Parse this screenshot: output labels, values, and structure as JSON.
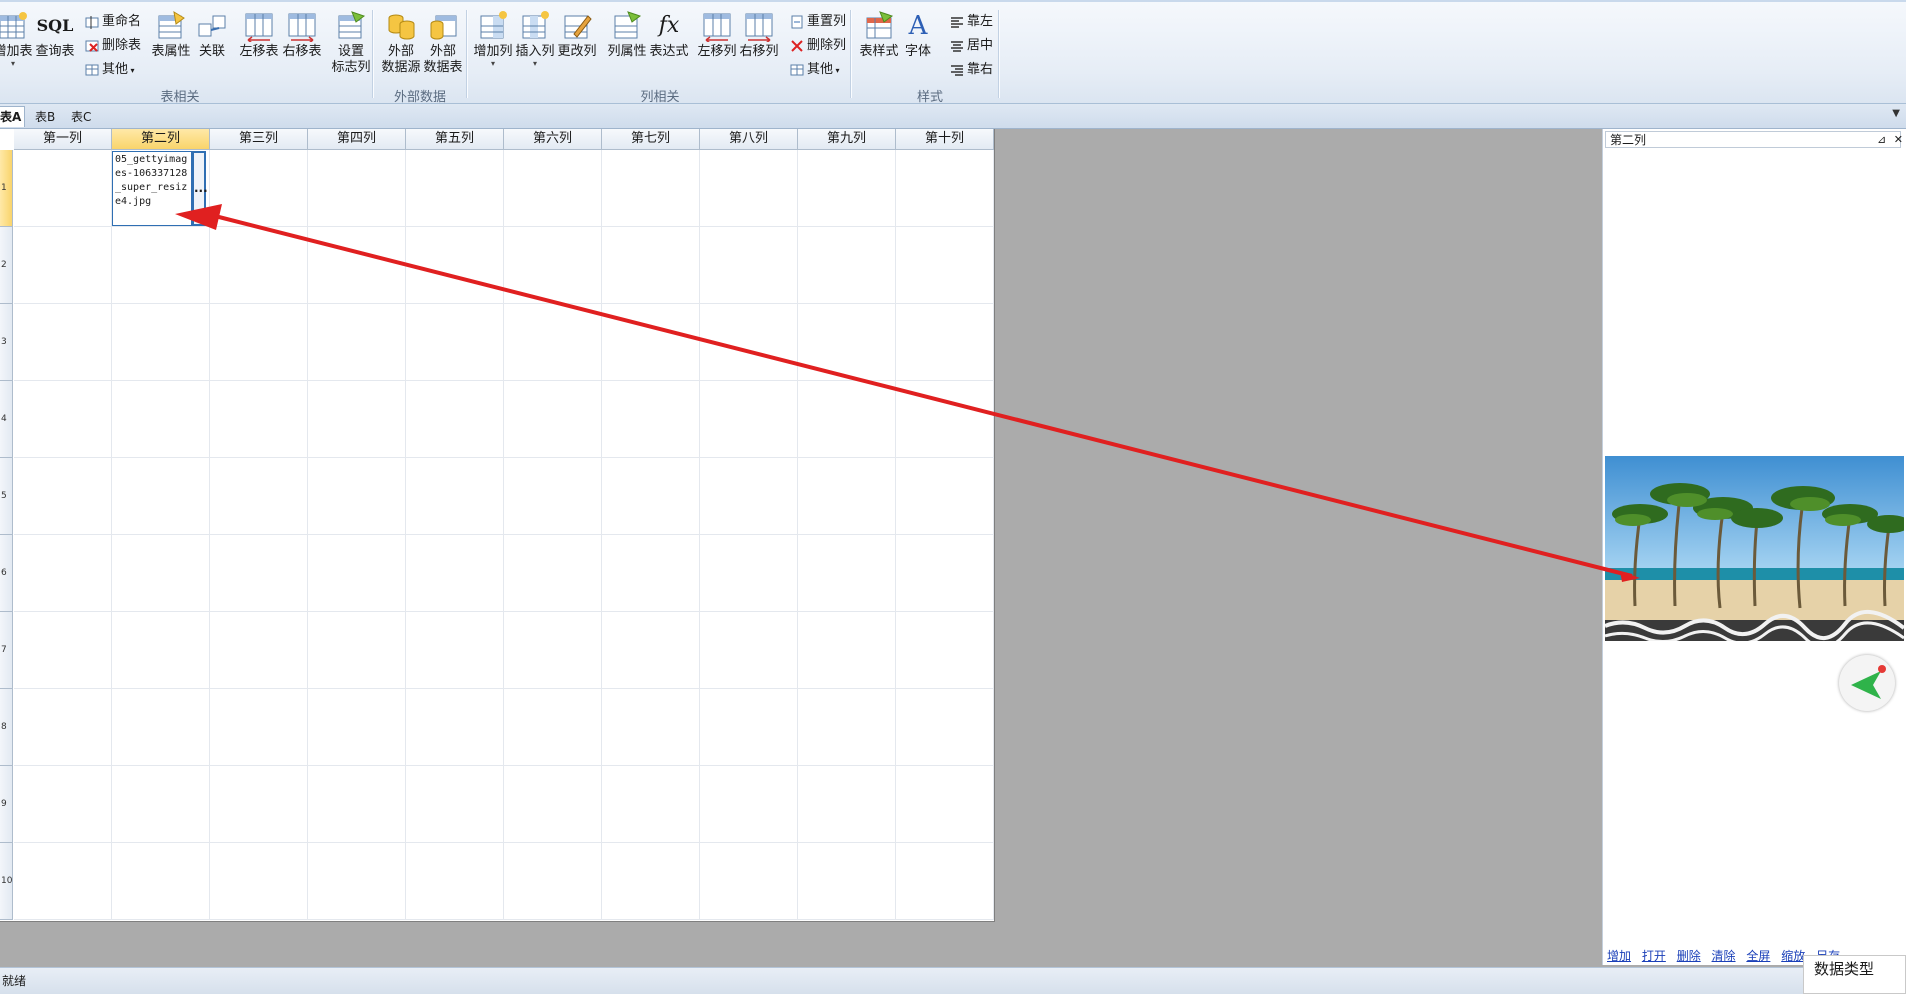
{
  "ribbon": {
    "buttons": {
      "add_table": "增加表",
      "query_table": "查询表",
      "rename": "重命名",
      "delete_table": "删除表",
      "other1": "其他",
      "table_props": "表属性",
      "relate": "关联",
      "move_table_left": "左移表",
      "move_table_right": "右移表",
      "set_flag_col": "设置\n标志列",
      "ext_source": "外部\n数据源",
      "ext_table": "外部\n数据表",
      "add_col": "增加列",
      "insert_col": "插入列",
      "change_col": "更改列",
      "col_props": "列属性",
      "expression": "表达式",
      "move_col_left": "左移列",
      "move_col_right": "右移列",
      "reset_col": "重置列",
      "delete_col": "删除列",
      "other2": "其他",
      "table_style": "表样式",
      "font": "字体",
      "align_left": "靠左",
      "align_center": "居中",
      "align_right": "靠右"
    },
    "sql_icon_text": "SQL",
    "fx_icon_text": "fx",
    "font_icon_text": "A",
    "groups": {
      "table": "表相关",
      "external": "外部数据",
      "column": "列相关",
      "style": "样式"
    }
  },
  "tabs": [
    "表A",
    "表B",
    "表C"
  ],
  "tab_menu_glyph": "▼",
  "grid": {
    "columns": [
      "第一列",
      "第二列",
      "第三列",
      "第四列",
      "第五列",
      "第六列",
      "第七列",
      "第八列",
      "第九列",
      "第十列"
    ],
    "row_labels": [
      "1",
      "2",
      "3",
      "4",
      "5",
      "6",
      "7",
      "8",
      "9",
      "10"
    ],
    "selected_column": 1,
    "selected_row": 0,
    "cell_value": "05_gettyimages-106337128_super_resize4.jpg",
    "ellipsis": "..."
  },
  "panel": {
    "title": "第二列",
    "pin_glyph": "⊿",
    "close_glyph": "✕",
    "links": [
      "增加",
      "打开",
      "删除",
      "清除",
      "全屏",
      "缩放",
      "另存"
    ]
  },
  "data_type_label": "数据类型",
  "status_text": "就绪",
  "colors": {
    "accent": "#2f6fb3",
    "selected_header": "#f9d46b",
    "arrow": "#e02020"
  }
}
